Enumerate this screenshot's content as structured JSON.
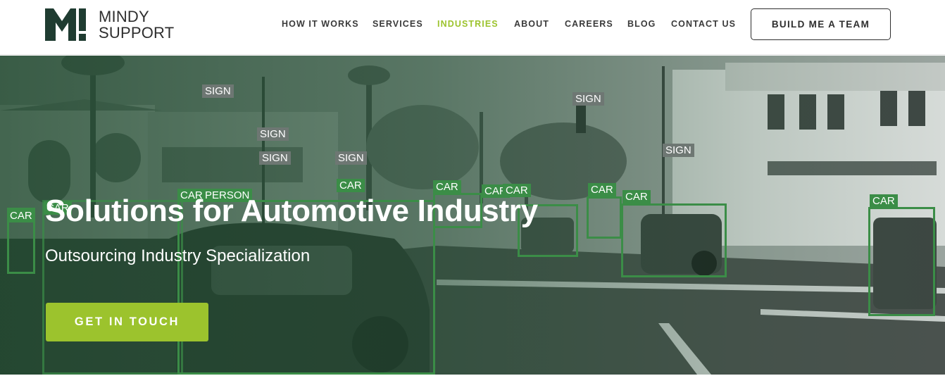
{
  "brand": {
    "logo_line1": "MINDY",
    "logo_line2": "SUPPORT",
    "logo_icon": "mindy-support-m-icon",
    "logo_color": "#1f3c31"
  },
  "nav": {
    "items": [
      {
        "label": "HOW IT WORKS",
        "active": false
      },
      {
        "label": "SERVICES",
        "active": false
      },
      {
        "label": "INDUSTRIES",
        "active": true
      },
      {
        "label": "ABOUT",
        "active": false
      },
      {
        "label": "CAREERS",
        "active": false
      },
      {
        "label": "BLOG",
        "active": false
      },
      {
        "label": "CONTACT US",
        "active": false
      }
    ],
    "cta_label": "BUILD ME A TEAM",
    "active_color": "#9cc32d"
  },
  "hero": {
    "title": "Solutions for Automotive Industry",
    "subtitle": "Outsourcing Industry Specialization",
    "cta_label": "GET IN TOUCH",
    "cta_color": "#9cc32d",
    "overlay_color": "#2f6b43",
    "detection_labels": {
      "sign_1": "SIGN",
      "sign_2": "SIGN",
      "sign_3": "SIGN",
      "sign_4": "SIGN",
      "sign_5": "SIGN",
      "sign_6": "SIGN",
      "car_1": "CAR",
      "car_2": "CAR",
      "car_3": "CAR",
      "car_4": "CAR",
      "car_5": "CAR",
      "car_6": "CAR",
      "car_7": "CAR",
      "car_8": "CAR",
      "car_9": "CAR",
      "car_10": "CAR",
      "person_1": "PERSON"
    },
    "detection_color": "#3b8d47"
  }
}
